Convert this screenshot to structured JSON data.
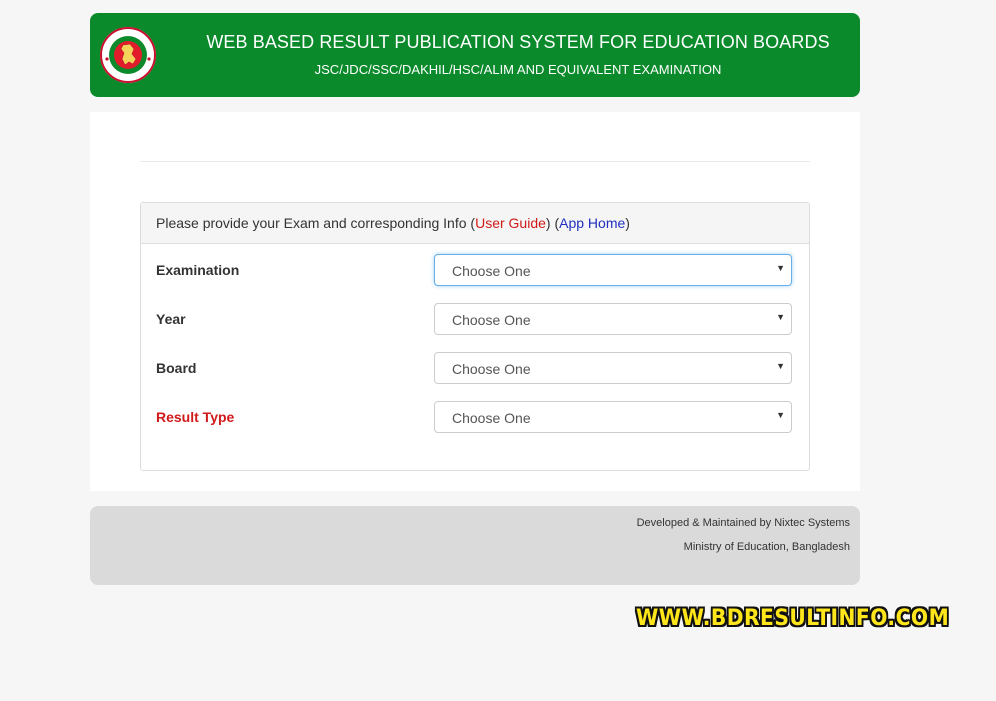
{
  "header": {
    "title": "WEB BASED RESULT PUBLICATION SYSTEM FOR EDUCATION BOARDS",
    "subtitle": "JSC/JDC/SSC/DAKHIL/HSC/ALIM AND EQUIVALENT EXAMINATION",
    "logo_icon": "government-seal-icon",
    "color": "#0b8a2c"
  },
  "panel": {
    "prompt": "Please provide your Exam and corresponding Info",
    "user_guide": "User Guide",
    "app_home": "App Home",
    "open_paren": "(",
    "close_paren": ")"
  },
  "form": {
    "examination": {
      "label": "Examination",
      "value": "Choose One"
    },
    "year": {
      "label": "Year",
      "value": "Choose One"
    },
    "board": {
      "label": "Board",
      "value": "Choose One"
    },
    "result_type": {
      "label": "Result Type",
      "value": "Choose One"
    }
  },
  "footer": {
    "line1": "Developed & Maintained by Nixtec Systems",
    "line2": "Ministry of Education, Bangladesh"
  },
  "watermark": "WWW.BDRESULTINFO.COM"
}
